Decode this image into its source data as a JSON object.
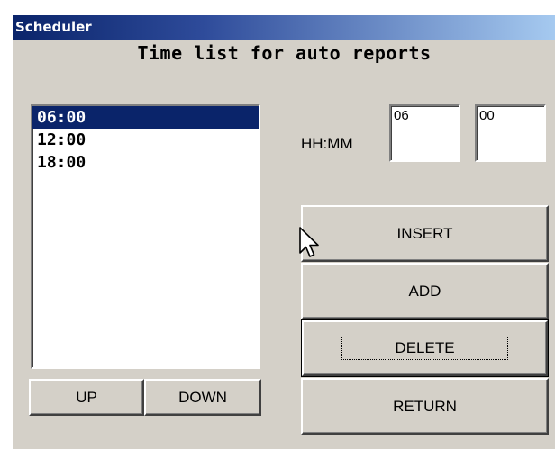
{
  "window": {
    "title": "Scheduler"
  },
  "heading": "Time list for auto reports",
  "time_list": {
    "items": [
      "06:00",
      "12:00",
      "18:00"
    ],
    "selected_index": 0
  },
  "time_entry": {
    "label": "HH:MM",
    "hours": "06",
    "minutes": "00"
  },
  "buttons": {
    "insert": "INSERT",
    "add": "ADD",
    "delete": "DELETE",
    "return": "RETURN",
    "up": "UP",
    "down": "DOWN"
  },
  "colors": {
    "window_bg": "#d4d0c8",
    "selection_bg": "#0a246a",
    "titlebar_start": "#0a246a",
    "titlebar_end": "#a6caf0"
  }
}
